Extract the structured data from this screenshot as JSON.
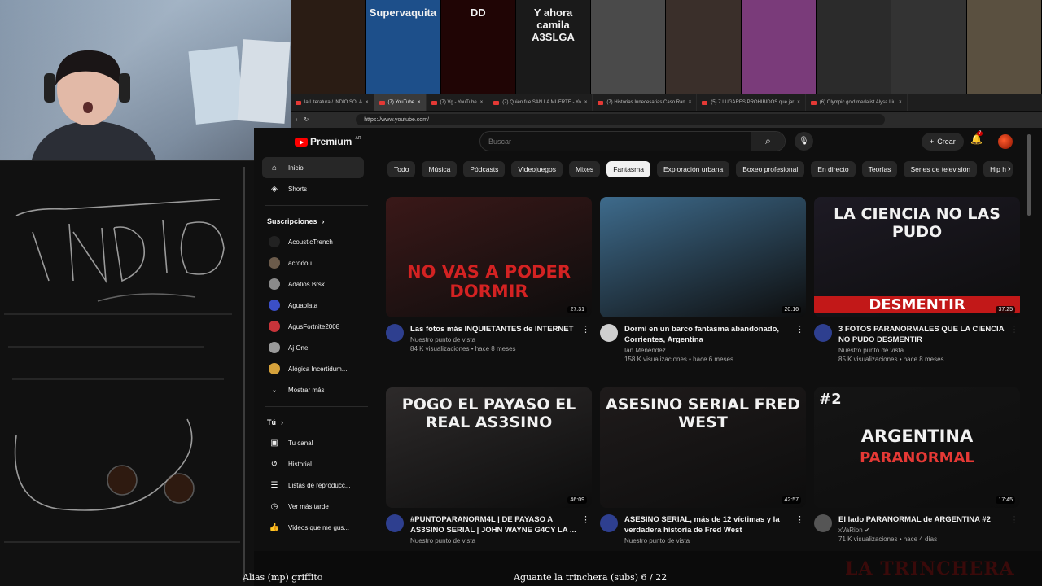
{
  "browser": {
    "tabs": [
      {
        "label": "la Literatura / INDIO SOLA",
        "active": false
      },
      {
        "label": "(7) YouTube",
        "active": true
      },
      {
        "label": "(7) Vg - YouTube",
        "active": false
      },
      {
        "label": "(7) Quién fue SAN LA MUERTE - Yo",
        "active": false
      },
      {
        "label": "(7) Historias Innecesarias Caso Ran",
        "active": false
      },
      {
        "label": "(5) 7 LUGARES PROHIBIDOS que jar",
        "active": false
      },
      {
        "label": "(6) Olympic gold medalist Alysa Liu",
        "active": false
      }
    ],
    "url": "https://www.youtube.com/"
  },
  "banner": {
    "tiles": [
      {
        "text": "",
        "color": "#2a1c14"
      },
      {
        "text": "Supervaquita",
        "color": "#1d4f8a"
      },
      {
        "text": "DD",
        "color": "#200505"
      },
      {
        "text": "Y ahora camila A3SLGA",
        "color": "#1a1a1a"
      },
      {
        "text": "",
        "color": "#4a4a4a"
      },
      {
        "text": "",
        "color": "#3a2f2a"
      },
      {
        "text": "",
        "color": "#7a3b7a"
      },
      {
        "text": "",
        "color": "#2b2b2b"
      },
      {
        "text": "",
        "color": "#333"
      },
      {
        "text": "",
        "color": "#5a5040"
      }
    ]
  },
  "youtube": {
    "logo_text": "Premium",
    "logo_region": "AR",
    "search_placeholder": "Buscar",
    "create_label": "Crear",
    "notification_count": "7",
    "sidebar": {
      "main": [
        {
          "label": "Inicio",
          "icon": "home-icon",
          "active": true
        },
        {
          "label": "Shorts",
          "icon": "shorts-icon",
          "active": false
        }
      ],
      "subscriptions_title": "Suscripciones",
      "subscriptions": [
        {
          "label": "AcousticTrench",
          "color": "#222"
        },
        {
          "label": "acrodou",
          "color": "#6b5b4b"
        },
        {
          "label": "Adatios Brsk",
          "color": "#8a8a8a"
        },
        {
          "label": "Aguaplata",
          "color": "#3b4fc7"
        },
        {
          "label": "AgusFortnite2008",
          "color": "#c8343a"
        },
        {
          "label": "Aj One",
          "color": "#9a9a9a"
        },
        {
          "label": "Alógica Incertidum...",
          "color": "#d6a23b"
        }
      ],
      "show_more": "Mostrar más",
      "you_title": "Tú",
      "you_items": [
        {
          "label": "Tu canal",
          "icon": "channel-icon"
        },
        {
          "label": "Historial",
          "icon": "history-icon"
        },
        {
          "label": "Listas de reproducc...",
          "icon": "playlist-icon"
        },
        {
          "label": "Ver más tarde",
          "icon": "clock-icon"
        },
        {
          "label": "Videos que me gus...",
          "icon": "like-icon"
        }
      ]
    },
    "chips": [
      "Todo",
      "Música",
      "Pódcasts",
      "Videojuegos",
      "Mixes",
      "Fantasma",
      "Exploración urbana",
      "Boxeo profesional",
      "En directo",
      "Teorías",
      "Series de televisión",
      "Hip h"
    ],
    "active_chip": "Fantasma",
    "videos": [
      {
        "thumb_text": "NO VAS A PODER DORMIR",
        "thumb_color": "#3a1818",
        "duration": "27:31",
        "title": "Las fotos más INQUIETANTES de INTERNET",
        "channel": "Nuestro punto de vista",
        "stats": "84 K visualizaciones • hace 8 meses",
        "av_color": "#2e3f8f"
      },
      {
        "thumb_text": "",
        "thumb_color": "#3e6b8c",
        "duration": "20:16",
        "title": "Dormí en un barco fantasma abandonado, Corrientes, Argentina",
        "channel": "Ian Menendez",
        "stats": "158 K visualizaciones • hace 6 meses",
        "av_color": "#cfcfcf"
      },
      {
        "thumb_text": "LA CIENCIA NO LAS PUDO",
        "thumb_text2": "DESMENTIR",
        "thumb_color": "#1d1a24",
        "duration": "37:25",
        "title": "3 FOTOS PARANORMALES QUE LA CIENCIA NO PUDO DESMENTIR",
        "channel": "Nuestro punto de vista",
        "stats": "85 K visualizaciones • hace 8 meses",
        "av_color": "#2e3f8f"
      },
      {
        "thumb_text": "POGO EL PAYASO EL REAL AS3SINO",
        "thumb_color": "#2d2a2a",
        "duration": "46:09",
        "title": "#PUNTOPARANORM4L | DE PAYASO A AS3SINO SERIAL | JOHN WAYNE G4CY LA ...",
        "channel": "Nuestro punto de vista",
        "stats": "",
        "av_color": "#2e3f8f"
      },
      {
        "thumb_text": "ASESINO SERIAL FRED WEST",
        "thumb_color": "#1f1b1b",
        "duration": "42:57",
        "title": "ASESINO SERIAL, más de 12 víctimas y la verdadera historia de Fred West",
        "channel": "Nuestro punto de vista",
        "stats": "",
        "av_color": "#2e3f8f"
      },
      {
        "thumb_text": "ARGENTINA",
        "thumb_text2": "PARANORMAL",
        "thumb_tag": "#2",
        "thumb_color": "#151515",
        "duration": "17:45",
        "title": "El lado PARANORMAL de ARGENTINA #2",
        "channel": "xVaRion ✔",
        "stats": "71 K visualizaciones • hace 4 días",
        "av_color": "#555"
      }
    ]
  },
  "overlay": {
    "left_text": "Alias (mp) griffito",
    "middle_text": "Aguante la trinchera (subs) 6 / 22",
    "right_text": "LA TRINCHERA"
  }
}
